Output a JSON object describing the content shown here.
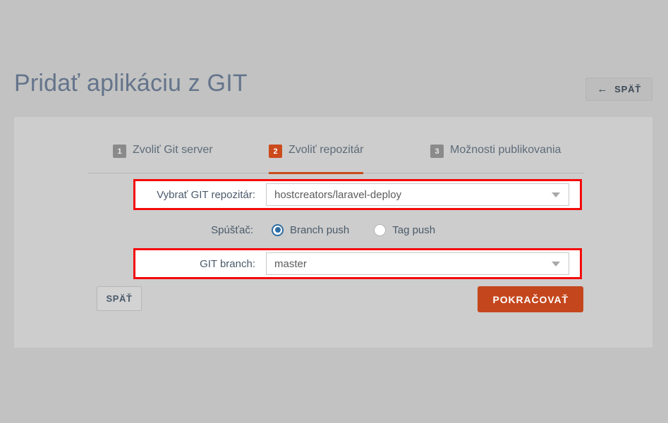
{
  "header": {
    "title": "Pridať aplikáciu z GIT",
    "back_button_label": "SPÄŤ",
    "back_arrow_icon": "arrow-left-icon"
  },
  "tabs": [
    {
      "number": "1",
      "label": "Zvoliť Git server",
      "active": false
    },
    {
      "number": "2",
      "label": "Zvoliť repozitár",
      "active": true
    },
    {
      "number": "3",
      "label": "Možnosti publikovania",
      "active": false
    }
  ],
  "form": {
    "repository": {
      "label": "Vybrať GIT repozitár:",
      "value": "hostcreators/laravel-deploy",
      "arrow_icon": "chevron-down-icon"
    },
    "trigger": {
      "label": "Spúšťač:",
      "options": [
        {
          "label": "Branch push",
          "selected": true
        },
        {
          "label": "Tag push",
          "selected": false
        }
      ]
    },
    "branch": {
      "label": "GIT branch:",
      "value": "master",
      "arrow_icon": "chevron-down-icon"
    }
  },
  "footer": {
    "back_label": "SPÄŤ",
    "continue_label": "POKRAČOVAŤ"
  },
  "colors": {
    "accent_orange": "#c4461c",
    "highlight_red": "#f40a0a",
    "radio_blue": "#2d6da4",
    "page_background": "#c2c2c2",
    "panel_background": "#cdcdcd",
    "title_text": "#64748b"
  }
}
